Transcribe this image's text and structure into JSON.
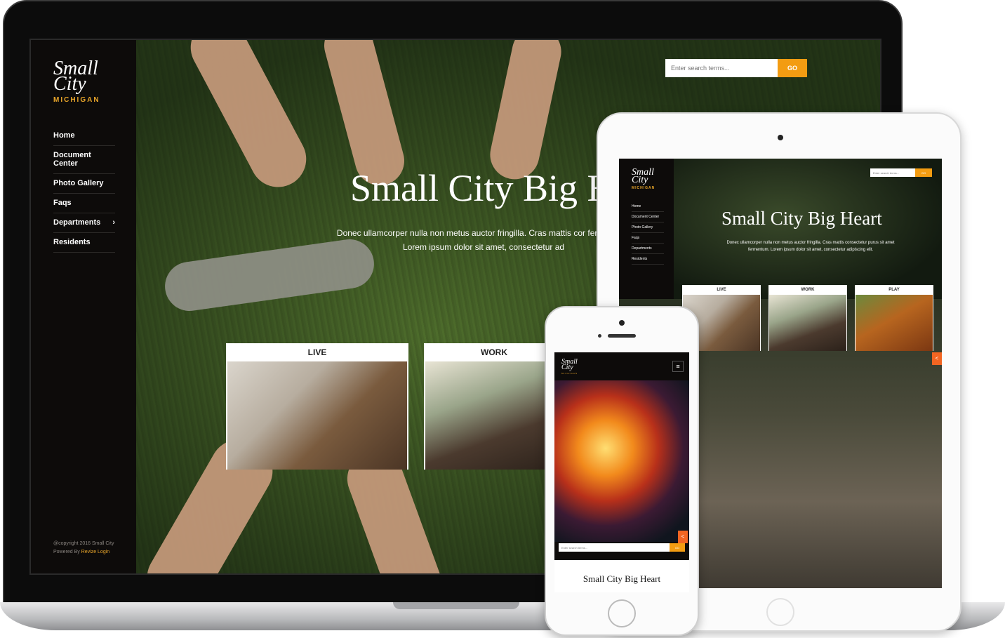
{
  "desktop": {
    "logo": {
      "line1": "Small",
      "line2": "City",
      "line3": "MICHIGAN"
    },
    "nav": [
      {
        "label": "Home"
      },
      {
        "label": "Document Center"
      },
      {
        "label": "Photo Gallery"
      },
      {
        "label": "Faqs"
      },
      {
        "label": "Departments",
        "chevron": "›"
      },
      {
        "label": "Residents"
      }
    ],
    "footer": {
      "copyright": "@copyright 2016 Small City",
      "powered": "Powered By ",
      "link": "Revize Login"
    },
    "search": {
      "placeholder": "Enter search terms...",
      "button": "GO"
    },
    "hero": {
      "title": "Small City Big H",
      "text": "Donec ullamcorper nulla non metus auctor fringilla. Cras mattis cor fermentum. Lorem ipsum dolor sit amet, consectetur ad"
    },
    "cards": [
      {
        "label": "LIVE"
      },
      {
        "label": "WORK"
      }
    ]
  },
  "tablet": {
    "logo": {
      "line1": "Small",
      "line2": "City",
      "line3": "MICHIGAN"
    },
    "nav": [
      {
        "label": "Home"
      },
      {
        "label": "Document Center"
      },
      {
        "label": "Photo Gallery"
      },
      {
        "label": "Faqs"
      },
      {
        "label": "Departments"
      },
      {
        "label": "Residents"
      }
    ],
    "search": {
      "placeholder": "Enter search terms...",
      "button": "GO"
    },
    "hero": {
      "title": "Small City Big Heart",
      "text": "Donec ullamcorper nulla non metus auctor fringilla. Cras mattis consectetur purus sit amet fermentum. Lorem ipsum dolor sit amet, consectetur adipiscing elit."
    },
    "cards": [
      {
        "label": "LIVE"
      },
      {
        "label": "WORK"
      },
      {
        "label": "PLAY"
      }
    ],
    "share_icon": "share-icon"
  },
  "phone": {
    "logo": {
      "line1": "Small",
      "line2": "City",
      "line3": "MICHIGAN"
    },
    "menu_icon": "≡",
    "search": {
      "placeholder": "Enter search terms...",
      "button": "GO"
    },
    "title": "Small City Big Heart"
  },
  "colors": {
    "accent": "#f39c12",
    "gold": "#e8a52a",
    "share": "#f26522",
    "sidebar": "#0d0b0a"
  }
}
